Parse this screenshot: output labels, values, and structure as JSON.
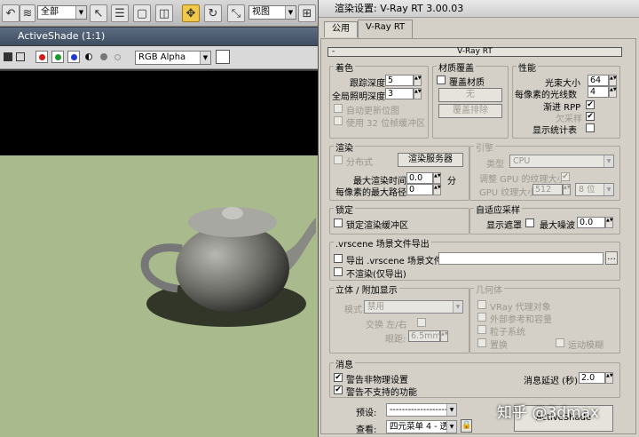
{
  "toolbar": {
    "filter_value": "全部",
    "coord_value": "视图"
  },
  "activeshade": {
    "title": "ActiveShade (1:1)",
    "channel_value": "RGB Alpha"
  },
  "dialog": {
    "title": "渲染设置: V-Ray RT 3.00.03",
    "tabs": [
      "公用",
      "V-Ray RT"
    ],
    "rollout_title": "V-Ray RT",
    "rollout_toggle": "-",
    "shading": {
      "title": "着色",
      "trace_depth_label": "跟踪深度",
      "trace_depth_value": "5",
      "gi_depth_label": "全局照明深度",
      "gi_depth_value": "3",
      "auto_update_label": "自动更新位图",
      "use_32bit_label": "使用 32 位帧缓冲区"
    },
    "material_override": {
      "title": "材质覆盖",
      "override_label": "覆盖材质",
      "none_button": "无",
      "exclude_button": "覆盖排除"
    },
    "performance": {
      "title": "性能",
      "rays_label": "光束大小",
      "rays_value": "64",
      "rays_per_pixel_label": "每像素的光线数",
      "rays_per_pixel_value": "4",
      "progressive_label": "渐进 RPP",
      "progressive_checked": "✔",
      "undersample_label": "欠采样",
      "undersample_checked": "✔",
      "stats_label": "显示统计表"
    },
    "render": {
      "title": "渲染",
      "distributed_label": "分布式",
      "servers_button": "渲染服务器",
      "max_time_label": "最大渲染时间",
      "max_time_value": "0.0",
      "max_time_unit": "分",
      "max_paths_label": "每像素的最大路径",
      "max_paths_value": "0"
    },
    "engine": {
      "title": "引擎",
      "type_label": "类型",
      "type_value": "CPU",
      "resize_label": "调整 GPU 的纹理大小",
      "resize_checked": "✔",
      "texture_size_label": "GPU 纹理大小",
      "texture_size_value": "512",
      "bits_value": "8 位"
    },
    "lock": {
      "title": "锁定",
      "lock_label": "锁定渲染缓冲区"
    },
    "adaptive": {
      "title": "自适应采样",
      "show_mask_label": "显示遮罩",
      "max_noise_label": "最大噪波",
      "max_noise_value": "0.0"
    },
    "vrscene": {
      "title": ".vrscene 场景文件导出",
      "export_label": "导出 .vrscene 场景文件",
      "browse_button": "...",
      "no_render_label": "不渲染(仅导出)"
    },
    "stereo": {
      "title": "立体 / 附加显示",
      "mode_label": "模式",
      "mode_value": "禁用",
      "swap_label": "交换 左/右",
      "eye_distance_label": "眼距:",
      "eye_distance_value": "6.5mm"
    },
    "geometry": {
      "title": "几何体",
      "proxy_label": "VRay 代理对象",
      "xref_label": "外部参考和容量",
      "particles_label": "粒子系统",
      "displacement_label": "置换",
      "motion_blur_label": "运动模糊"
    },
    "messages": {
      "title": "消息",
      "nonphysical_label": "警告非物理设置",
      "nonphysical_checked": "✔",
      "unsupported_label": "警告不支持的功能",
      "unsupported_checked": "✔",
      "delay_label": "消息延迟 (秒)",
      "delay_value": "2.0"
    },
    "footer": {
      "preset_label": "预设:",
      "preset_value": "--------------------",
      "view_label": "查看:",
      "view_value": "四元菜单 4 - 透",
      "render_button": "ActiveShade"
    }
  },
  "watermark": "知乎 @3dmax",
  "colors": {
    "dialog_bg": "#d4d0c8",
    "viewport_floor": "#a9bb8c",
    "active_tool": "#f2c84b"
  }
}
